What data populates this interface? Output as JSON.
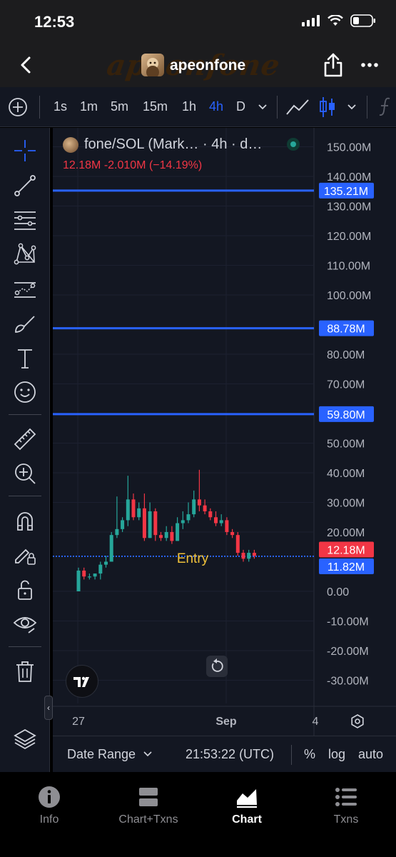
{
  "status_bar": {
    "time": "12:53"
  },
  "header": {
    "title": "apeonfone",
    "watermark": "apeonfone"
  },
  "timeframes": {
    "items": [
      "1s",
      "1m",
      "5m",
      "15m",
      "1h",
      "4h",
      "D"
    ],
    "active": "4h"
  },
  "chart": {
    "legend_title": "fone/SOL (Mark… · 4h · d…",
    "legend_values": "12.18M  -2.010M (−14.19%)",
    "y_axis_labels": [
      "150.00M",
      "140.00M",
      "130.00M",
      "120.00M",
      "110.00M",
      "100.00M",
      "80.00M",
      "70.00M",
      "60.00M",
      "50.00M",
      "40.00M",
      "30.00M",
      "20.00M",
      "0.00",
      "-10.00M",
      "-20.00M",
      "-30.00M"
    ],
    "x_axis_labels": [
      "27",
      "Sep",
      "4"
    ],
    "lines": [
      {
        "label": "135.21M",
        "value": 135.21
      },
      {
        "label": "88.78M",
        "value": 88.78
      },
      {
        "label": "59.80M",
        "value": 59.8
      }
    ],
    "entry_line": {
      "label": "Entry",
      "value": 11.82,
      "price_label": "11.82M"
    },
    "last_price": {
      "label": "12.18M",
      "value": 12.18
    },
    "colors": {
      "up": "#26a69a",
      "down": "#f23645",
      "line": "#2962ff",
      "entry_text": "#f0c23b"
    }
  },
  "chart_data": {
    "type": "candlestick",
    "y_unit": "M",
    "ylim": [
      -35,
      155
    ],
    "candles": [
      {
        "o": 0,
        "h": 8,
        "l": 0,
        "c": 7
      },
      {
        "o": 7,
        "h": 8,
        "l": 4,
        "c": 5
      },
      {
        "o": 5,
        "h": 6,
        "l": 4,
        "c": 5
      },
      {
        "o": 5,
        "h": 6,
        "l": 4,
        "c": 6
      },
      {
        "o": 6,
        "h": 10,
        "l": 4,
        "c": 9
      },
      {
        "o": 9,
        "h": 12,
        "l": 8,
        "c": 10
      },
      {
        "o": 10,
        "h": 20,
        "l": 10,
        "c": 19
      },
      {
        "o": 19,
        "h": 32,
        "l": 18,
        "c": 21
      },
      {
        "o": 21,
        "h": 25,
        "l": 20,
        "c": 24
      },
      {
        "o": 24,
        "h": 39,
        "l": 22,
        "c": 31
      },
      {
        "o": 31,
        "h": 33,
        "l": 24,
        "c": 25
      },
      {
        "o": 25,
        "h": 30,
        "l": 24,
        "c": 28
      },
      {
        "o": 28,
        "h": 33,
        "l": 17,
        "c": 18
      },
      {
        "o": 18,
        "h": 30,
        "l": 18,
        "c": 27
      },
      {
        "o": 27,
        "h": 28,
        "l": 17,
        "c": 19
      },
      {
        "o": 19,
        "h": 20,
        "l": 17,
        "c": 18
      },
      {
        "o": 18,
        "h": 22,
        "l": 17,
        "c": 20
      },
      {
        "o": 20,
        "h": 22,
        "l": 16,
        "c": 17
      },
      {
        "o": 17,
        "h": 25,
        "l": 17,
        "c": 23
      },
      {
        "o": 23,
        "h": 27,
        "l": 21,
        "c": 24
      },
      {
        "o": 24,
        "h": 30,
        "l": 23,
        "c": 26
      },
      {
        "o": 26,
        "h": 34,
        "l": 25,
        "c": 31
      },
      {
        "o": 31,
        "h": 41,
        "l": 27,
        "c": 29
      },
      {
        "o": 29,
        "h": 31,
        "l": 26,
        "c": 27
      },
      {
        "o": 27,
        "h": 28,
        "l": 24,
        "c": 25
      },
      {
        "o": 25,
        "h": 27,
        "l": 22,
        "c": 23
      },
      {
        "o": 23,
        "h": 26,
        "l": 22,
        "c": 24
      },
      {
        "o": 24,
        "h": 25,
        "l": 19,
        "c": 20
      },
      {
        "o": 20,
        "h": 21,
        "l": 18,
        "c": 19
      },
      {
        "o": 19,
        "h": 20,
        "l": 12,
        "c": 13
      },
      {
        "o": 13,
        "h": 14,
        "l": 10,
        "c": 11
      },
      {
        "o": 11,
        "h": 14,
        "l": 10,
        "c": 13
      },
      {
        "o": 13,
        "h": 14,
        "l": 11,
        "c": 12
      }
    ]
  },
  "date_range": {
    "label": "Date Range",
    "time": "21:53:22 (UTC)",
    "pct": "%",
    "log": "log",
    "auto": "auto"
  },
  "tabs": [
    {
      "label": "Info",
      "icon": "info-icon"
    },
    {
      "label": "Chart+Txns",
      "icon": "split-panel-icon"
    },
    {
      "label": "Chart",
      "icon": "area-chart-icon",
      "active": true
    },
    {
      "label": "Txns",
      "icon": "list-icon"
    }
  ]
}
